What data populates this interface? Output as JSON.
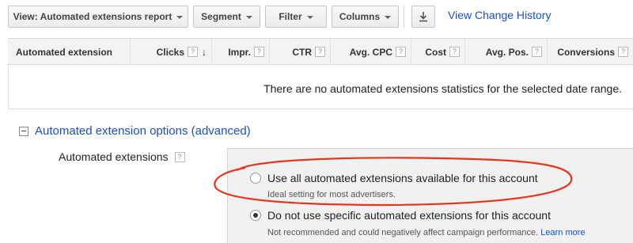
{
  "toolbar": {
    "view_label": "View: Automated extensions report",
    "segment_label": "Segment",
    "filter_label": "Filter",
    "columns_label": "Columns",
    "history_link": "View Change History"
  },
  "table": {
    "columns": [
      {
        "label": "Automated extension",
        "help": "",
        "sort": ""
      },
      {
        "label": "Clicks",
        "help": "?",
        "sort": "↓"
      },
      {
        "label": "Impr.",
        "help": "?",
        "sort": ""
      },
      {
        "label": "CTR",
        "help": "?",
        "sort": ""
      },
      {
        "label": "Avg. CPC",
        "help": "?",
        "sort": ""
      },
      {
        "label": "Cost",
        "help": "?",
        "sort": ""
      },
      {
        "label": "Avg. Pos.",
        "help": "?",
        "sort": ""
      },
      {
        "label": "Conversions",
        "help": "?",
        "sort": ""
      }
    ],
    "empty_message": "There are no automated extensions statistics for the selected date range."
  },
  "options": {
    "title": "Automated extension options (advanced)",
    "field_label": "Automated extensions",
    "field_help": "?",
    "choices": [
      {
        "label": "Use all automated extensions available for this account",
        "desc": "Ideal setting for most advertisers.",
        "selected": false
      },
      {
        "label": "Do not use specific automated extensions for this account",
        "desc": "Not recommended and could negatively affect campaign performance.",
        "selected": true,
        "link": "Learn more"
      }
    ]
  },
  "colors": {
    "link": "#1a4fc7",
    "highlight": "#e8341c"
  },
  "icons": {
    "download": "download-icon",
    "collapse": "collapse-minus-icon",
    "sort": "sort-down-arrow-icon"
  }
}
